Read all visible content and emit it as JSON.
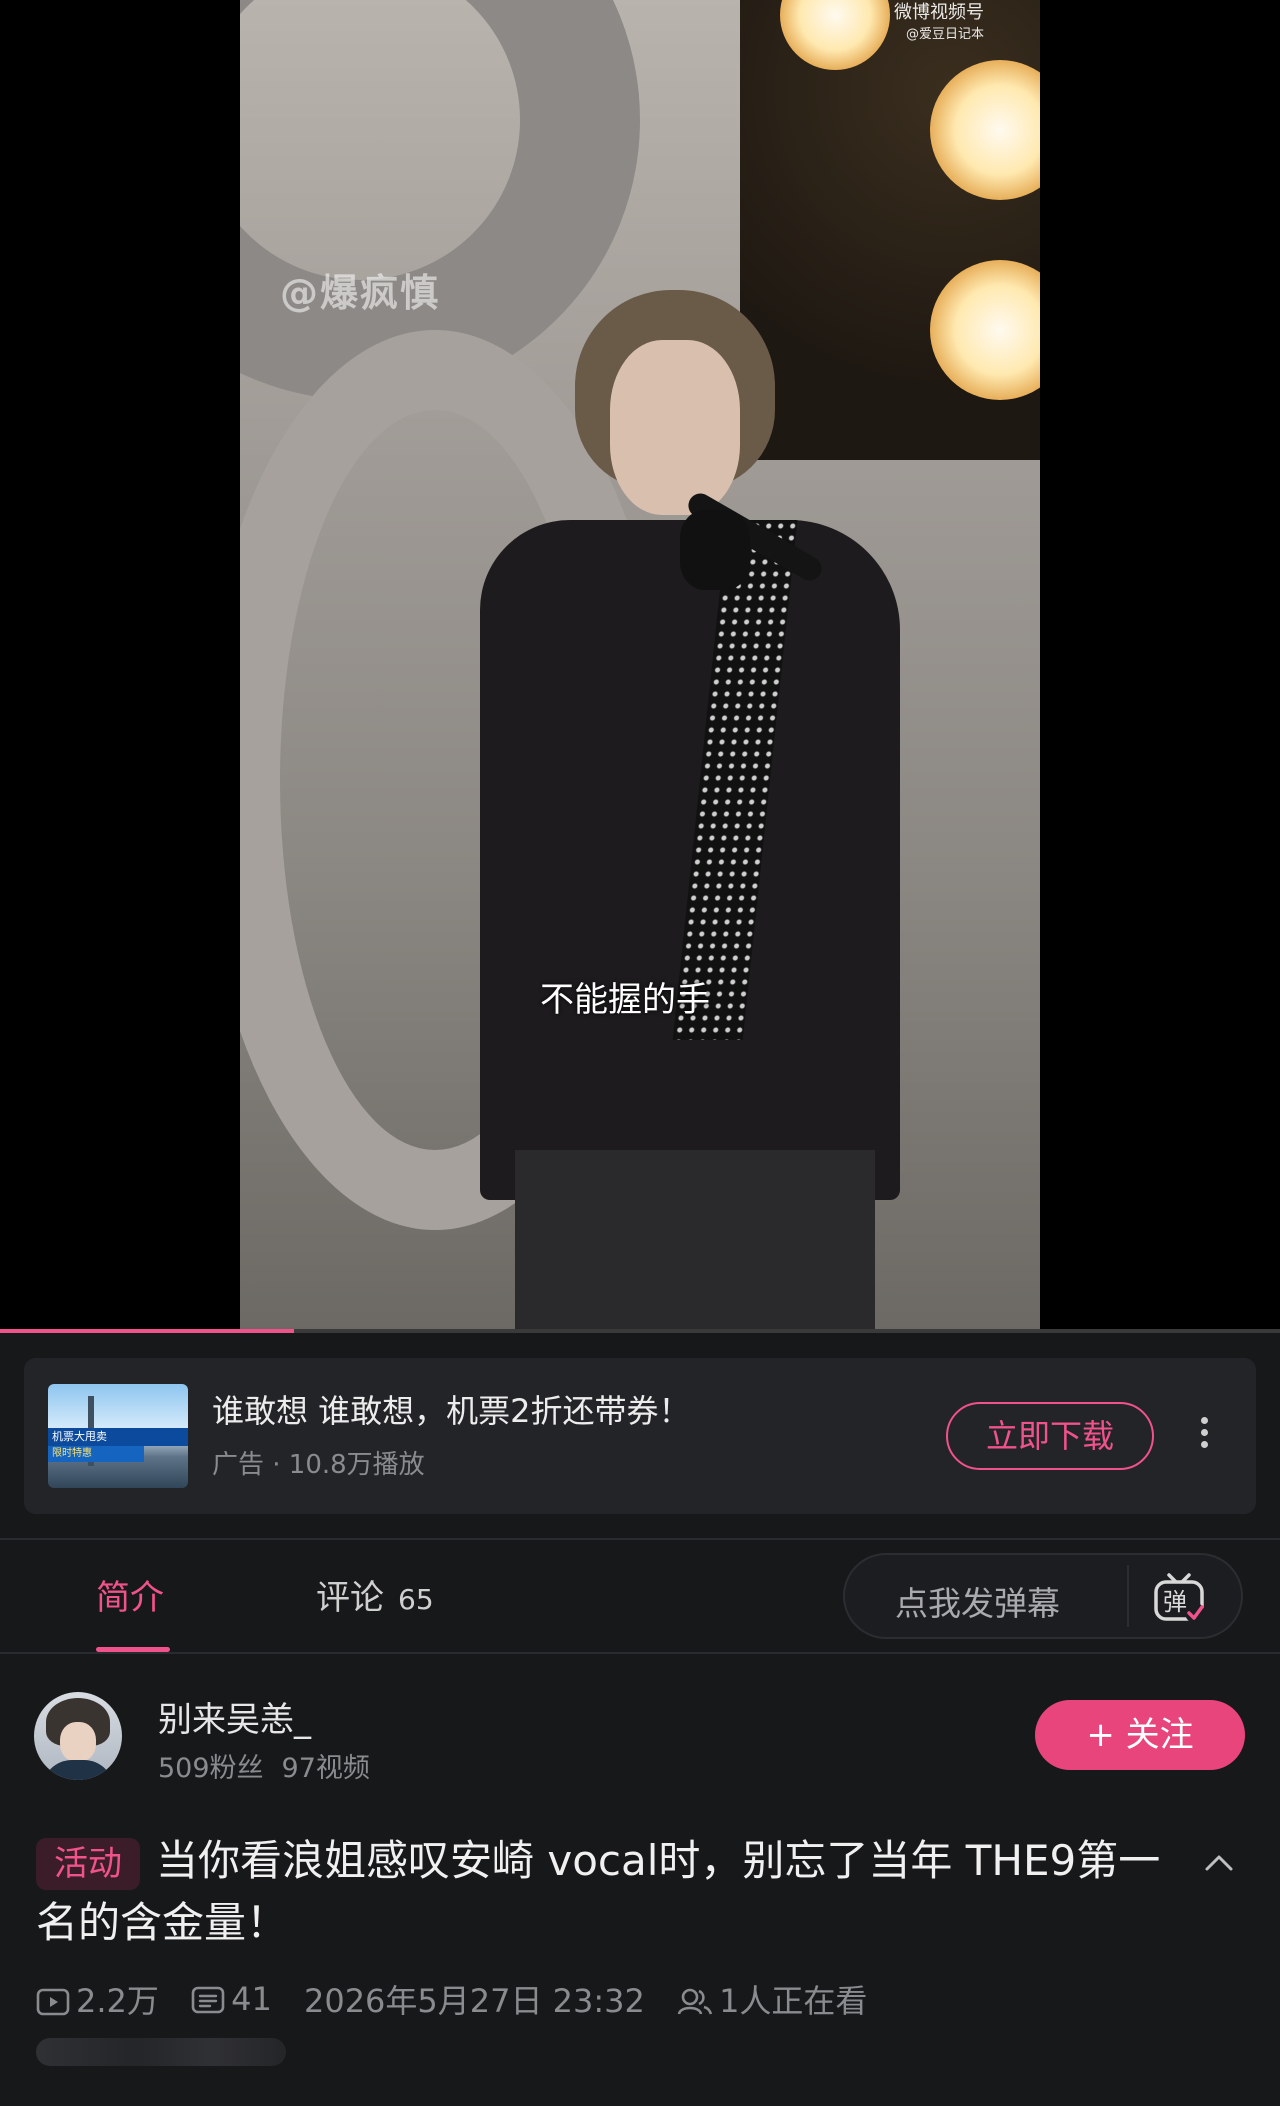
{
  "video": {
    "watermark_top": "微博视频号",
    "watermark_top_sub": "@爱豆日记本",
    "watermark_mid": "@爆疯慎",
    "subtitle": "不能握的手",
    "progress_fraction": 0.23
  },
  "ad": {
    "thumb_text_1": "机票大甩卖",
    "thumb_text_2": "限时特惠",
    "title": "谁敢想 谁敢想，机票2折还带券！",
    "meta": "广告 · 10.8万播放",
    "download_label": "立即下载",
    "more_icon": "more-vertical-icon"
  },
  "tabs": {
    "intro_label": "简介",
    "comments_label": "评论",
    "comments_count": "65"
  },
  "danmaku": {
    "placeholder": "点我发弹幕",
    "icon_label": "弹"
  },
  "uploader": {
    "name": "别来吴恙_",
    "fans": "509粉丝",
    "videos": "97视频",
    "follow_label": "+ 关注"
  },
  "post": {
    "tag": "活动",
    "title": "当你看浪姐感叹安崎 vocal时，别忘了当年 THE9第一名的含金量！"
  },
  "stats": {
    "plays": "2.2万",
    "danmaku_count": "41",
    "datetime": "2026年5月27日 23:32",
    "watching": "1人正在看"
  },
  "colors": {
    "accent": "#f0528a",
    "background": "#17181a",
    "card": "#232427",
    "muted_text": "#8a8b8f"
  }
}
